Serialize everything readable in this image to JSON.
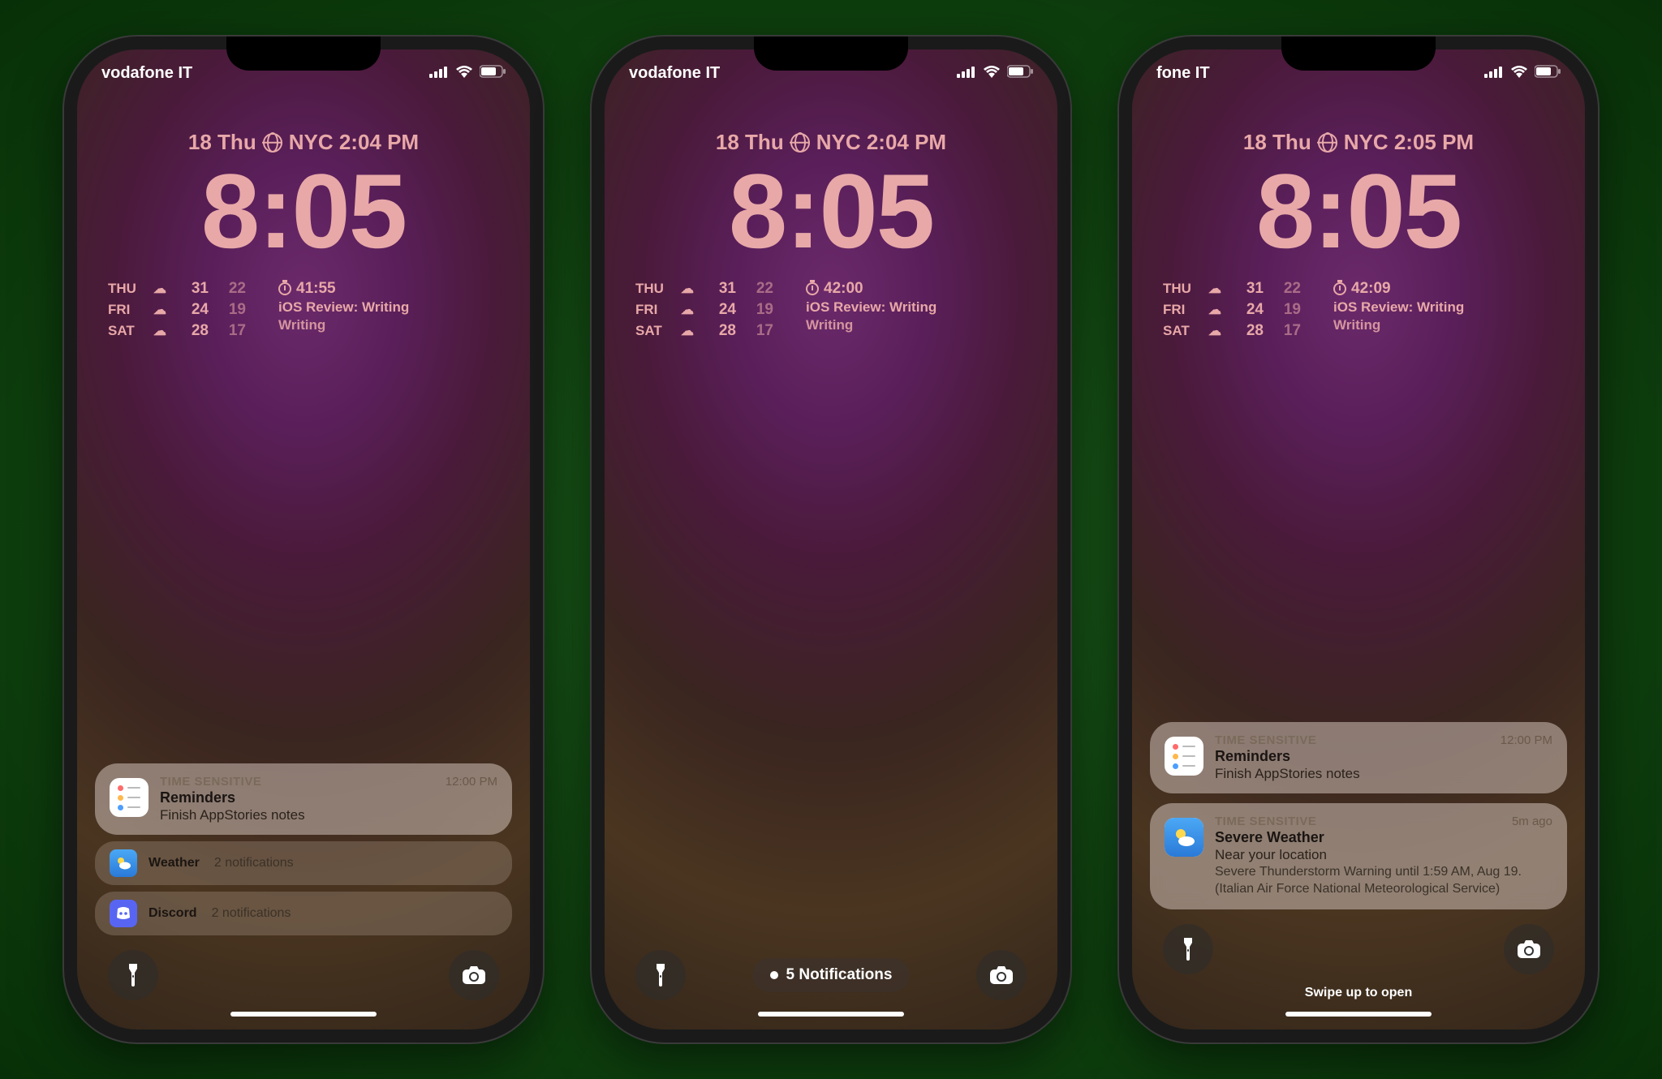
{
  "phones": [
    {
      "status": {
        "carrier": "vodafone IT"
      },
      "date": {
        "left": "18 Thu",
        "right": "NYC 2:04 PM"
      },
      "clock": "8:05",
      "weather": [
        {
          "day": "THU",
          "hi": "31",
          "lo": "22"
        },
        {
          "day": "FRI",
          "hi": "24",
          "lo": "19"
        },
        {
          "day": "SAT",
          "hi": "28",
          "lo": "17"
        }
      ],
      "timer": {
        "elapsed": "41:55",
        "line2": "iOS Review: Writing",
        "line3": "Writing"
      },
      "notif1": {
        "tag": "TIME SENSITIVE",
        "time": "12:00 PM",
        "title": "Reminders",
        "sub": "Finish AppStories notes"
      },
      "collapsed": [
        {
          "app": "Weather",
          "count": "2 notifications"
        },
        {
          "app": "Discord",
          "count": "2 notifications"
        }
      ]
    },
    {
      "status": {
        "carrier": "vodafone IT"
      },
      "date": {
        "left": "18 Thu",
        "right": "NYC 2:04 PM"
      },
      "clock": "8:05",
      "weather": [
        {
          "day": "THU",
          "hi": "31",
          "lo": "22"
        },
        {
          "day": "FRI",
          "hi": "24",
          "lo": "19"
        },
        {
          "day": "SAT",
          "hi": "28",
          "lo": "17"
        }
      ],
      "timer": {
        "elapsed": "42:00",
        "line2": "iOS Review: Writing",
        "line3": "Writing"
      },
      "notif_count": "5 Notifications"
    },
    {
      "status": {
        "carrier": "fone IT"
      },
      "date": {
        "left": "18 Thu",
        "right": "NYC 2:05 PM"
      },
      "clock": "8:05",
      "weather": [
        {
          "day": "THU",
          "hi": "31",
          "lo": "22"
        },
        {
          "day": "FRI",
          "hi": "24",
          "lo": "19"
        },
        {
          "day": "SAT",
          "hi": "28",
          "lo": "17"
        }
      ],
      "timer": {
        "elapsed": "42:09",
        "line2": "iOS Review: Writing",
        "line3": "Writing"
      },
      "notif1": {
        "tag": "TIME SENSITIVE",
        "time": "12:00 PM",
        "title": "Reminders",
        "sub": "Finish AppStories notes"
      },
      "notif2": {
        "tag": "TIME SENSITIVE",
        "time": "5m ago",
        "title": "Severe Weather",
        "sub": "Near your location",
        "body": "Severe Thunderstorm Warning until 1:59 AM, Aug 19. (Italian Air Force National Meteorological Service)"
      },
      "swipe_hint": "Swipe up to open"
    }
  ]
}
